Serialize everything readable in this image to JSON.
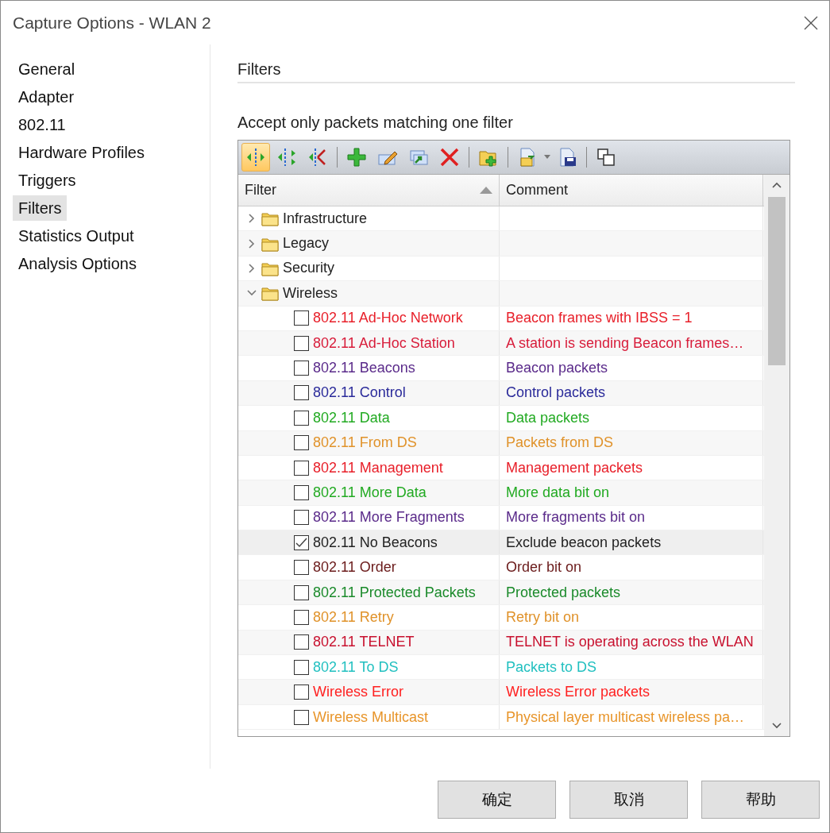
{
  "window": {
    "title": "Capture Options - WLAN 2"
  },
  "sidebar": {
    "items": [
      {
        "label": "General",
        "selected": false
      },
      {
        "label": "Adapter",
        "selected": false
      },
      {
        "label": "802.11",
        "selected": false
      },
      {
        "label": "Hardware Profiles",
        "selected": false
      },
      {
        "label": "Triggers",
        "selected": false
      },
      {
        "label": "Filters",
        "selected": true
      },
      {
        "label": "Statistics Output",
        "selected": false
      },
      {
        "label": "Analysis Options",
        "selected": false
      }
    ]
  },
  "section": {
    "title": "Filters",
    "mode_label": "Accept only packets matching one filter"
  },
  "table": {
    "columns": [
      {
        "label": "Filter",
        "sorted": true
      },
      {
        "label": "Comment",
        "sorted": false
      }
    ],
    "rows": [
      {
        "kind": "folder",
        "name": "Infrastructure",
        "expanded": false
      },
      {
        "kind": "folder",
        "name": "Legacy",
        "expanded": false
      },
      {
        "kind": "folder",
        "name": "Security",
        "expanded": false
      },
      {
        "kind": "folder",
        "name": "Wireless",
        "expanded": true,
        "children": [
          {
            "kind": "filter",
            "name": "802.11 Ad-Hoc Network",
            "comment": "Beacon frames with IBSS = 1",
            "checked": false,
            "color": "#e8202a"
          },
          {
            "kind": "filter",
            "name": "802.11 Ad-Hoc Station",
            "comment": "A station is sending Beacon frames…",
            "checked": false,
            "color": "#d81c3a"
          },
          {
            "kind": "filter",
            "name": "802.11 Beacons",
            "comment": "Beacon packets",
            "checked": false,
            "color": "#5a2a8a"
          },
          {
            "kind": "filter",
            "name": "802.11 Control",
            "comment": "Control packets",
            "checked": false,
            "color": "#2a2a9a"
          },
          {
            "kind": "filter",
            "name": "802.11 Data",
            "comment": "Data packets",
            "checked": false,
            "color": "#22aa22"
          },
          {
            "kind": "filter",
            "name": "802.11 From DS",
            "comment": "Packets from DS",
            "checked": false,
            "color": "#e0922a"
          },
          {
            "kind": "filter",
            "name": "802.11 Management",
            "comment": "Management packets",
            "checked": false,
            "color": "#e81e28"
          },
          {
            "kind": "filter",
            "name": "802.11 More Data",
            "comment": "More data bit on",
            "checked": false,
            "color": "#22aa22"
          },
          {
            "kind": "filter",
            "name": "802.11 More Fragments",
            "comment": "More fragments bit on",
            "checked": false,
            "color": "#5a2a8a"
          },
          {
            "kind": "filter",
            "name": "802.11 No Beacons",
            "comment": "Exclude beacon packets",
            "checked": true,
            "color": "#222222"
          },
          {
            "kind": "filter",
            "name": "802.11 Order",
            "comment": "Order bit on",
            "checked": false,
            "color": "#6a1a1a"
          },
          {
            "kind": "filter",
            "name": "802.11 Protected Packets",
            "comment": "Protected packets",
            "checked": false,
            "color": "#1a8a2a"
          },
          {
            "kind": "filter",
            "name": "802.11 Retry",
            "comment": "Retry bit on",
            "checked": false,
            "color": "#e0922a"
          },
          {
            "kind": "filter",
            "name": "802.11 TELNET",
            "comment": "TELNET is operating across the WLAN",
            "checked": false,
            "color": "#c8102e"
          },
          {
            "kind": "filter",
            "name": "802.11 To DS",
            "comment": "Packets to DS",
            "checked": false,
            "color": "#22c0c0"
          },
          {
            "kind": "filter",
            "name": "Wireless Error",
            "comment": "Wireless Error packets",
            "checked": false,
            "color": "#ff2020"
          },
          {
            "kind": "filter",
            "name": "Wireless Multicast",
            "comment": "Physical layer multicast wireless pa…",
            "checked": false,
            "color": "#e8952a"
          }
        ]
      }
    ]
  },
  "buttons": [
    "确定",
    "取消",
    "帮助"
  ]
}
